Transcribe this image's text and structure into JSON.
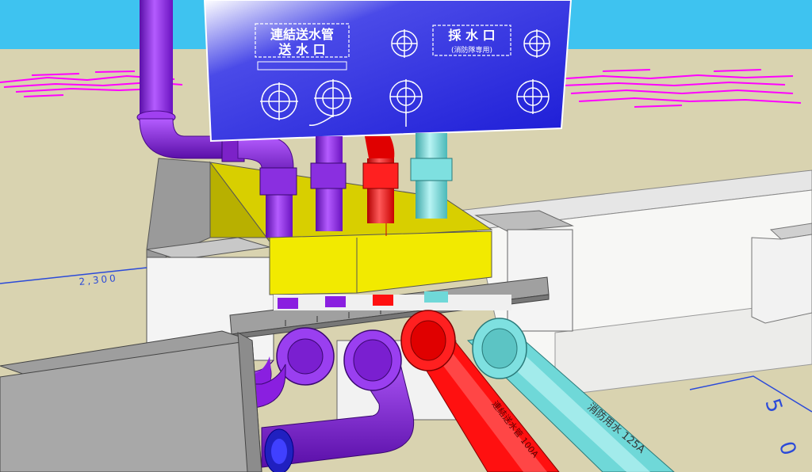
{
  "colors": {
    "sky": "#3ec3f0",
    "ground": "#d9d3b0",
    "panel_blue": "#1c1cd6",
    "pipe_purple": "#8a1fe0",
    "pipe_red": "#ff1010",
    "pipe_cyan": "#6fd8d8",
    "block_yellow": "#f2ea00",
    "wall_white": "#f4f4f4",
    "wall_gray": "#a8a8a8",
    "magenta": "#ff00ff",
    "dim_blue": "#2b4ad9"
  },
  "panel": {
    "label_connect_line1": "連結送水管",
    "label_connect_line2": "送 水 口",
    "label_fire_line1": "採 水 口",
    "label_fire_line2": "(消防隊専用)"
  },
  "annotations": {
    "dimension_left": "2,300",
    "dimension_right": "5 0",
    "pipe_label": "消防用水 125A",
    "pipe_label_red": "連結送水管 100A"
  },
  "icons": {
    "connector_left_1": "valve-outlet-icon",
    "connector_left_2": "valve-outlet-icon",
    "connector_right_1": "valve-outlet-icon",
    "connector_right_2": "valve-outlet-icon"
  }
}
